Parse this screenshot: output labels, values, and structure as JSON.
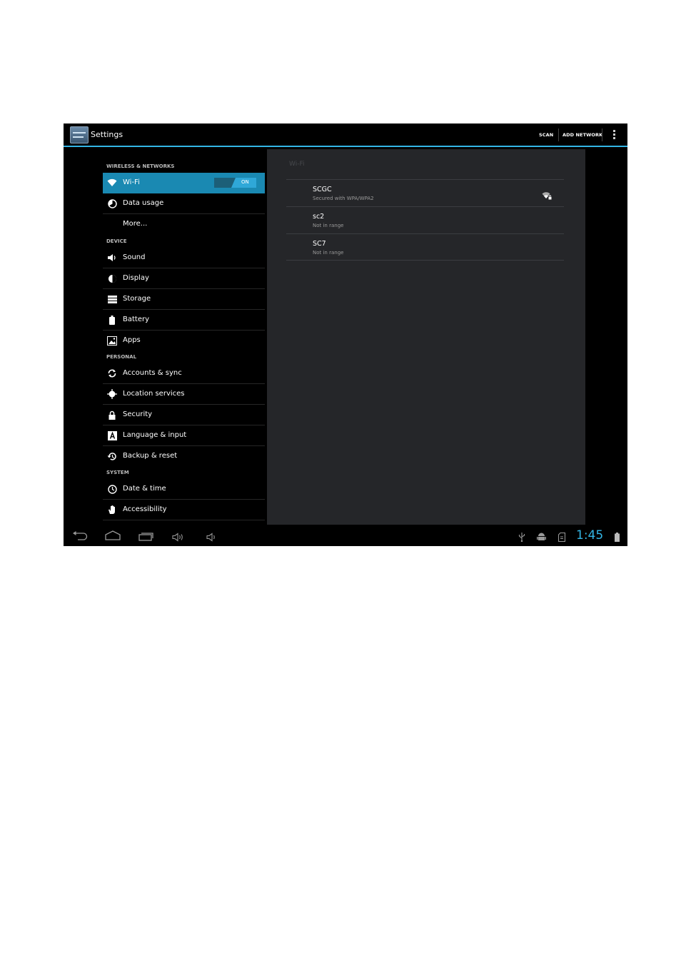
{
  "action_bar": {
    "title": "Settings",
    "actions": [
      "SCAN",
      "ADD NETWORK"
    ],
    "overflow_icon": "overflow-menu-icon",
    "accent_color": "#33b5e5"
  },
  "sidebar": {
    "headers": [
      "WIRELESS & NETWORKS",
      "DEVICE",
      "PERSONAL",
      "SYSTEM"
    ],
    "items": [
      {
        "label": "Wi-Fi",
        "icon": "wifi-icon",
        "selected": true
      },
      {
        "label": "Data usage",
        "icon": "data-usage-icon"
      },
      {
        "label": "More..."
      },
      {
        "label": "Sound",
        "icon": "speaker-icon"
      },
      {
        "label": "Display",
        "icon": "display-icon"
      },
      {
        "label": "Storage",
        "icon": "storage-icon"
      },
      {
        "label": "Battery",
        "icon": "battery-icon"
      },
      {
        "label": "Apps",
        "icon": "apps-icon"
      },
      {
        "label": "Accounts & sync",
        "icon": "sync-icon"
      },
      {
        "label": "Location services",
        "icon": "location-icon"
      },
      {
        "label": "Security",
        "icon": "lock-icon"
      },
      {
        "label": "Language & input",
        "icon": "language-icon"
      },
      {
        "label": "Backup & reset",
        "icon": "backup-icon"
      },
      {
        "label": "Date & time",
        "icon": "clock-icon"
      },
      {
        "label": "Accessibility",
        "icon": "hand-icon"
      }
    ],
    "wifi_toggle": "ON"
  },
  "wifi_panel": {
    "title": "Wi-Fi",
    "networks": [
      {
        "name": "SCGC",
        "status": "Secured with WPA/WPA2",
        "signal_icon": "wifi-signal-lock-icon"
      },
      {
        "name": "sc2",
        "status": "Not in range"
      },
      {
        "name": "SC7",
        "status": "Not in range"
      }
    ]
  },
  "system_bar": {
    "time": "1:45",
    "nav_icons": [
      "back-icon",
      "home-icon",
      "recents-icon",
      "volume-up-icon",
      "volume-down-icon"
    ],
    "status_icons": [
      "usb-icon",
      "android-debug-icon",
      "sd-card-icon",
      "battery-icon"
    ]
  }
}
